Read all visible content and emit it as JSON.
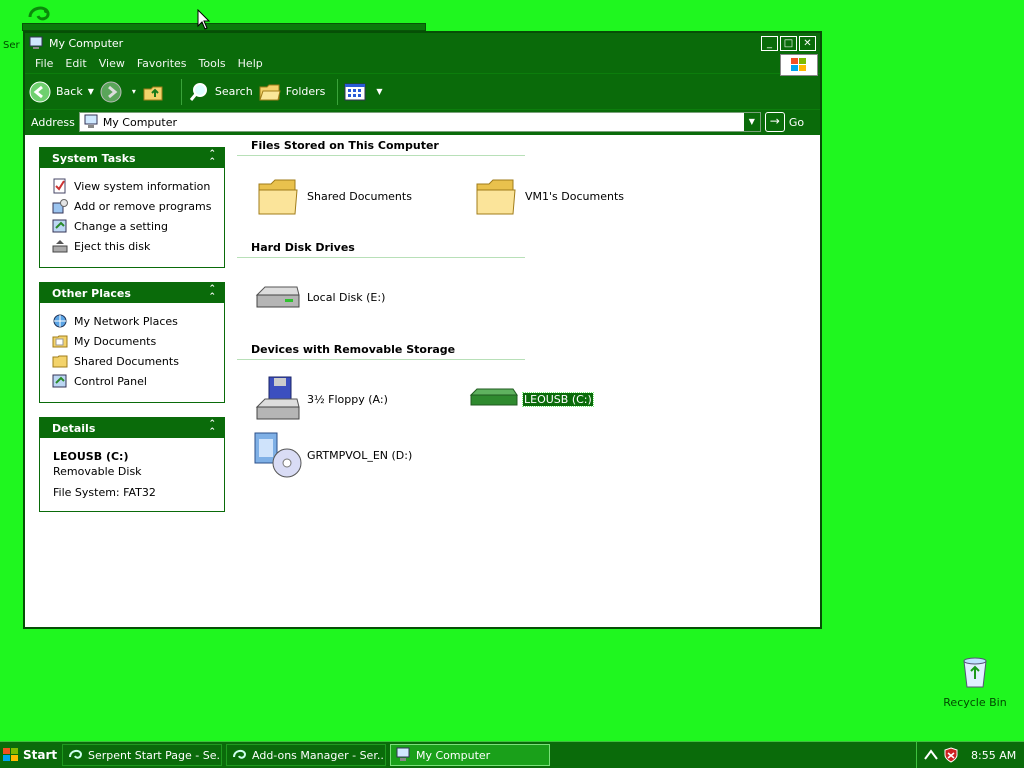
{
  "desktop": {
    "top_left_label": "Ser",
    "recycle_bin": "Recycle Bin"
  },
  "window": {
    "title": "My Computer",
    "controls": {
      "minimize": "_",
      "maximize": "□",
      "close": "✕"
    },
    "menu": [
      "File",
      "Edit",
      "View",
      "Favorites",
      "Tools",
      "Help"
    ],
    "toolbar": {
      "back": "Back",
      "search": "Search",
      "folders": "Folders"
    },
    "address": {
      "label": "Address",
      "value": "My Computer",
      "go": "Go"
    }
  },
  "left_pane": {
    "system_tasks": {
      "title": "System Tasks",
      "items": [
        "View system information",
        "Add or remove programs",
        "Change a setting",
        "Eject this disk"
      ]
    },
    "other_places": {
      "title": "Other Places",
      "items": [
        "My Network Places",
        "My Documents",
        "Shared Documents",
        "Control Panel"
      ]
    },
    "details": {
      "title": "Details",
      "name": "LEOUSB (C:)",
      "type": "Removable Disk",
      "filesystem": "File System: FAT32"
    }
  },
  "main": {
    "sections": {
      "files": "Files Stored on This Computer",
      "hdd": "Hard Disk Drives",
      "removable": "Devices with Removable Storage"
    },
    "files_items": [
      "Shared Documents",
      "VM1's Documents"
    ],
    "hdd_items": [
      "Local Disk (E:)"
    ],
    "removable_items": [
      "3½ Floppy (A:)",
      "LEOUSB (C:)",
      "GRTMPVOL_EN (D:)"
    ]
  },
  "taskbar": {
    "start": "Start",
    "tasks": [
      "Serpent Start Page - Se...",
      "Add-ons Manager - Ser...",
      "My Computer"
    ],
    "clock": "8:55 AM"
  },
  "colors": {
    "desktop": "#1ff71f",
    "chrome": "#0a6b0a",
    "selection": "#0a6b0a"
  }
}
